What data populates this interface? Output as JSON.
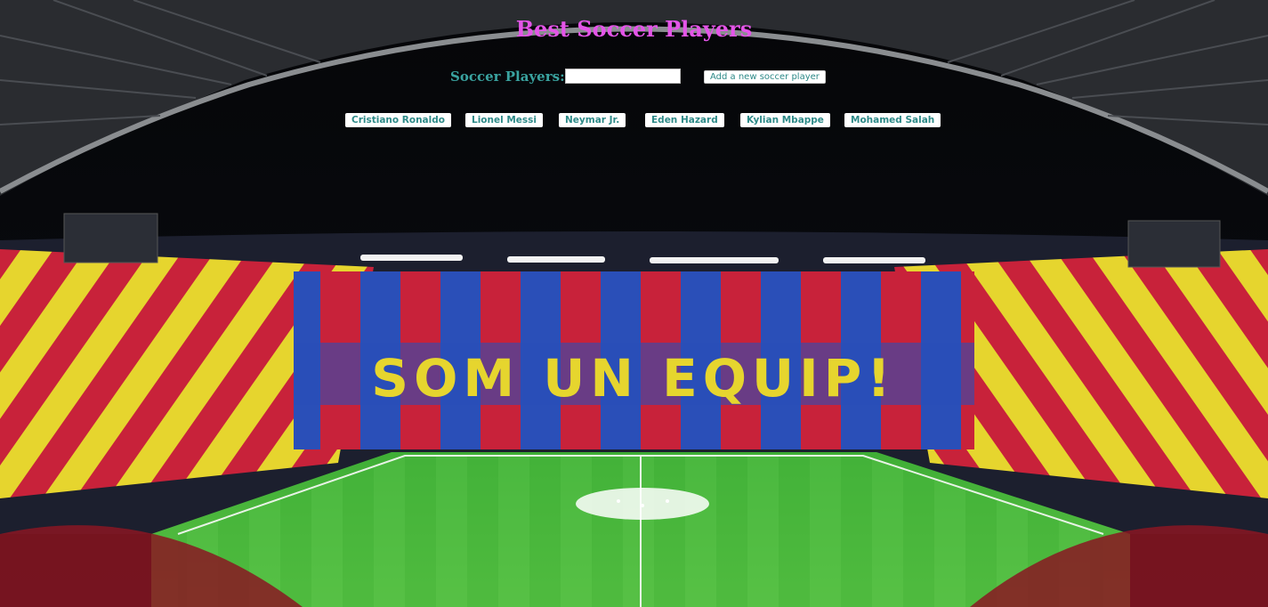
{
  "title": "Best Soccer Players",
  "form": {
    "label": "Soccer Players:",
    "input_value": "",
    "add_button": "Add a new soccer player"
  },
  "players": [
    "Cristiano Ronaldo",
    "Lionel Messi",
    "Neymar Jr.",
    "Eden Hazard",
    "Kylian Mbappe",
    "Mohamed Salah"
  ],
  "background": {
    "banner_text": "SOM UN EQUIP!",
    "colors": {
      "red": "#c8223a",
      "yellow": "#e6d52e",
      "blue": "#2a4fb8",
      "pitch": "#4db83a",
      "title": "#e455e8",
      "accent": "#3aa3a0"
    }
  }
}
